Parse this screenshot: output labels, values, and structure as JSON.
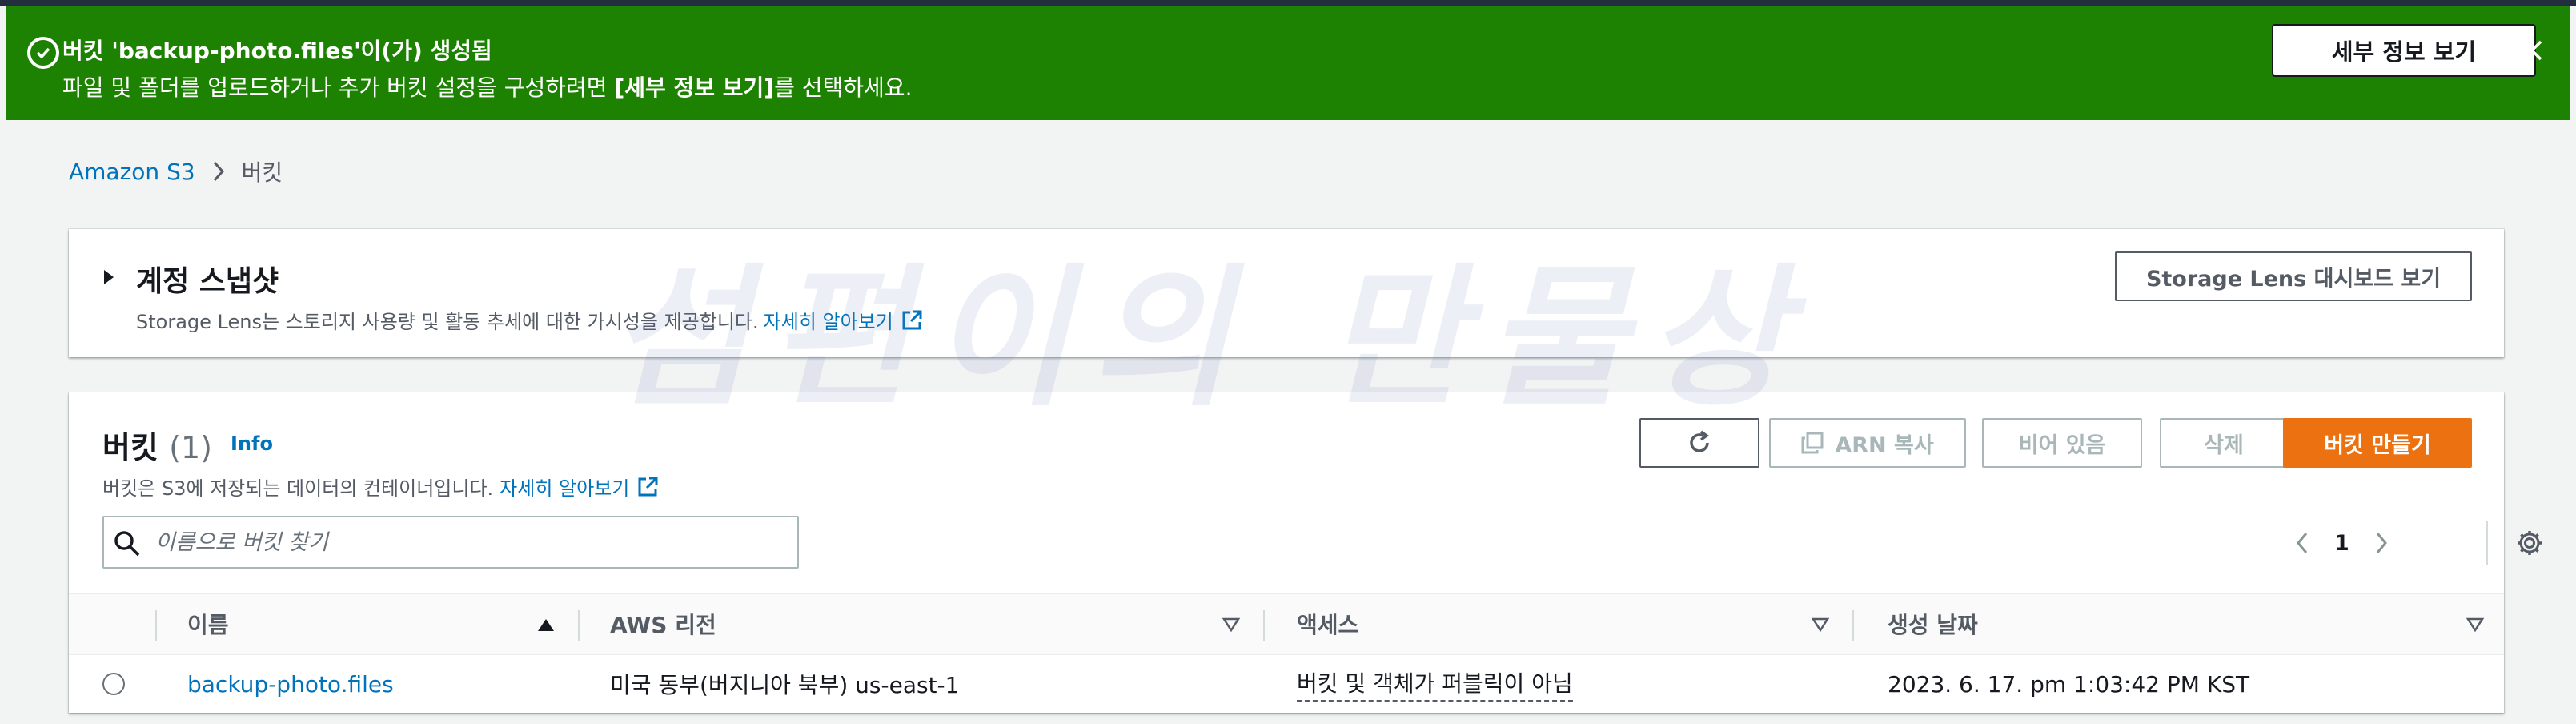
{
  "flash": {
    "title": "버킷 'backup-photo.files'이(가) 생성됨",
    "message_before": "파일 및 폴더를 업로드하거나 추가 버킷 설정을 구성하려면 ",
    "message_bold": "[세부 정보 보기]",
    "message_after": "를 선택하세요.",
    "details_button": "세부 정보 보기",
    "color": "#1d8102"
  },
  "breadcrumb": {
    "root": "Amazon S3",
    "current": "버킷"
  },
  "snapshot": {
    "title": "계정 스냅샷",
    "description": "Storage Lens는 스토리지 사용량 및 활동 추세에 대한 가시성을 제공합니다.",
    "learn_more": "자세히 알아보기",
    "lens_button": "Storage Lens 대시보드 보기"
  },
  "buckets": {
    "title": "버킷",
    "count": "(1)",
    "info": "Info",
    "description": "버킷은 S3에 저장되는 데이터의 컨테이너입니다.",
    "learn_more": "자세히 알아보기",
    "buttons": {
      "arn_copy": "ARN 복사",
      "empty": "비어 있음",
      "delete": "삭제",
      "create": "버킷 만들기"
    },
    "search_placeholder": "이름으로 버킷 찾기",
    "page": "1",
    "columns": [
      "이름",
      "AWS 리전",
      "액세스",
      "생성 날짜"
    ],
    "rows": [
      {
        "name": "backup-photo.files",
        "region": "미국 동부(버지니아 북부) us-east-1",
        "access": "버킷 및 객체가 퍼블릭이 아님",
        "created": "2023. 6. 17. pm 1:03:42 PM KST"
      }
    ],
    "accent_color": "#ec7211"
  },
  "watermark": "섬편이의 만물상",
  "icons": [
    "check-circle-icon",
    "close-icon",
    "chevron-right-icon",
    "caret-right-icon",
    "external-link-icon",
    "refresh-icon",
    "copy-icon",
    "search-icon",
    "chevron-left-icon",
    "gear-icon",
    "sort-ascending-icon",
    "sort-descending-icon"
  ]
}
